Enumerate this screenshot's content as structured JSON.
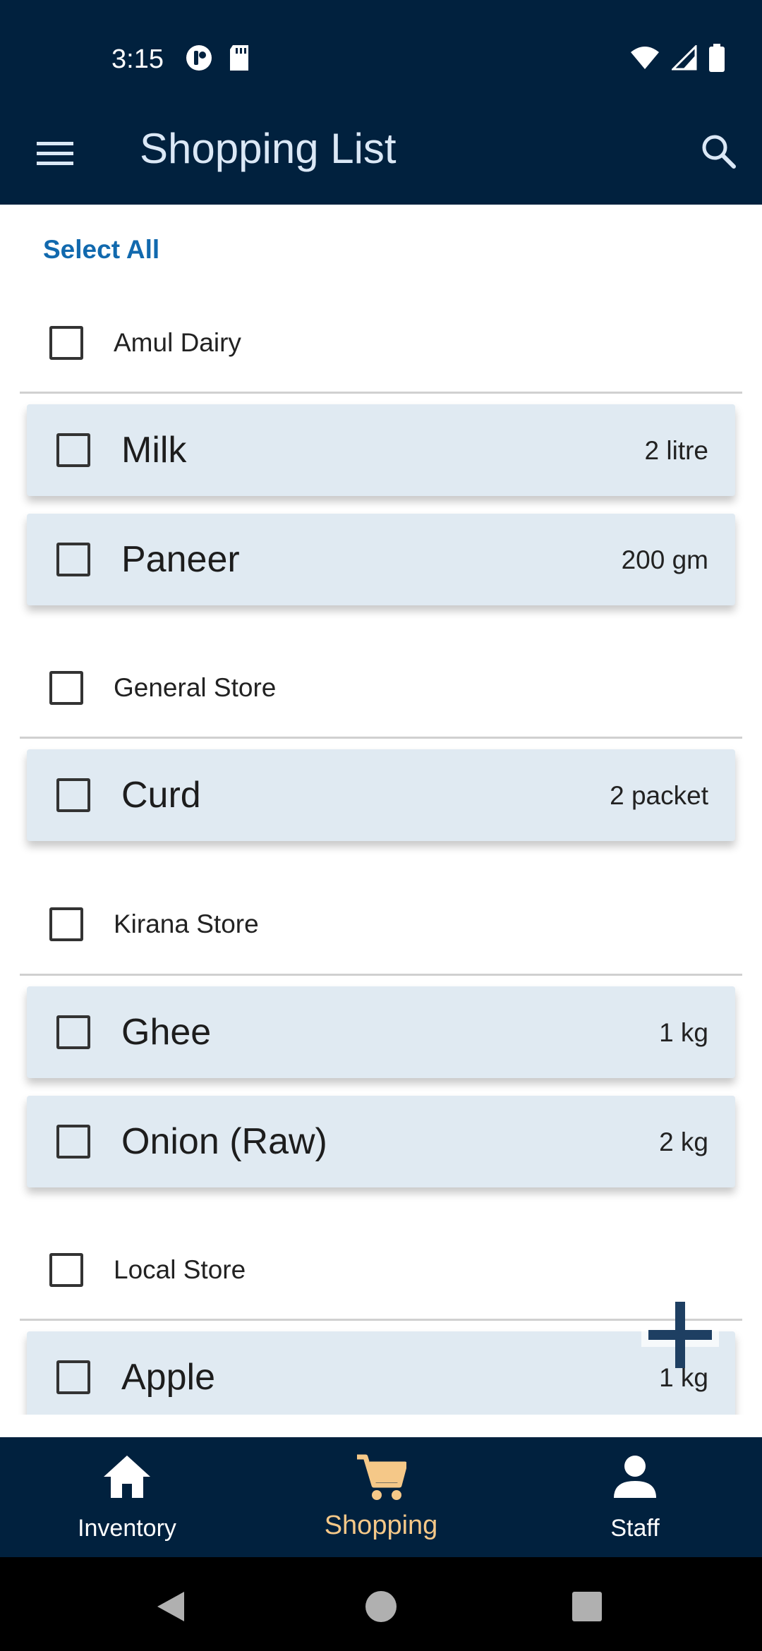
{
  "status_bar": {
    "time": "3:15"
  },
  "app_bar": {
    "title": "Shopping List"
  },
  "list": {
    "select_all": "Select All",
    "groups": [
      {
        "name": "Amul Dairy",
        "items": [
          {
            "name": "Milk",
            "qty": "2 litre"
          },
          {
            "name": "Paneer",
            "qty": "200 gm"
          }
        ]
      },
      {
        "name": "General Store",
        "items": [
          {
            "name": "Curd",
            "qty": "2 packet"
          }
        ]
      },
      {
        "name": "Kirana Store",
        "items": [
          {
            "name": "Ghee",
            "qty": "1 kg"
          },
          {
            "name": "Onion (Raw)",
            "qty": "2 kg"
          }
        ]
      },
      {
        "name": "Local Store",
        "items": [
          {
            "name": "Apple",
            "qty": "1 kg"
          }
        ]
      }
    ]
  },
  "bottom_nav": {
    "items": [
      {
        "label": "Inventory",
        "icon": "home-icon"
      },
      {
        "label": "Shopping",
        "icon": "cart-icon",
        "active": true
      },
      {
        "label": "Staff",
        "icon": "person-icon"
      }
    ]
  },
  "colors": {
    "app_bar": "#01213e",
    "accent": "#1169ae",
    "active_nav": "#f5c888",
    "card": "#e0eaf2"
  }
}
